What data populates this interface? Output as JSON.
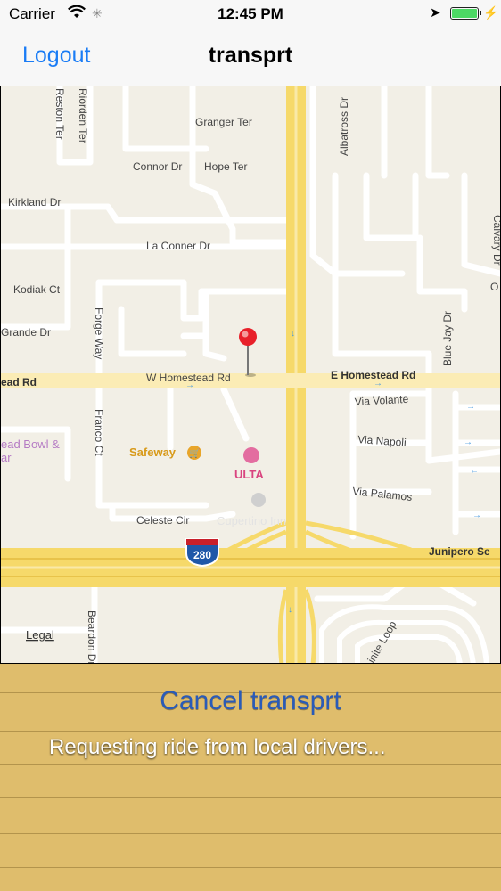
{
  "status_bar": {
    "carrier": "Carrier",
    "time": "12:45 PM",
    "wifi_icon": "wifi-icon",
    "location_icon": "location-arrow-icon",
    "battery_icon": "battery-icon",
    "battery_color": "#4cd964"
  },
  "navbar": {
    "logout_label": "Logout",
    "title": "transprt"
  },
  "map": {
    "streets": {
      "reston_ter": "Reston Ter",
      "riorden_ter": "Riorden Ter",
      "granger_ter": "Granger Ter",
      "connor_dr": "Connor Dr",
      "hope_ter": "Hope Ter",
      "albatross_dr": "Albatross Dr",
      "kirkland_dr": "Kirkland Dr",
      "la_conner_dr": "La Conner Dr",
      "calvary_dr": "Calvary Dr",
      "kodiak_ct": "Kodiak Ct",
      "grande_dr": "Grande Dr",
      "forge_way": "Forge Way",
      "blue_jay_dr": "Blue Jay Dr",
      "w_homestead": "W Homestead Rd",
      "e_homestead": "E Homestead Rd",
      "homestead_left": "ead Rd",
      "via_volante": "Via Volante",
      "via_napoli": "Via Napoli",
      "via_palamos": "Via Palamos",
      "franco_ct": "Franco Ct",
      "celeste_cir": "Celeste Cir",
      "junipero": "Junipero Se",
      "beardon_dr": "Beardon Dr",
      "inite_loop": "inite Loop",
      "legal": "Legal",
      "o_letter": "O"
    },
    "pois": {
      "bowl": "ead Bowl &",
      "bowl2": "ar",
      "safeway": "Safeway",
      "ulta": "ULTA",
      "cupertino_inn": "Cupertino Inn"
    },
    "highway_shield": "280",
    "colors": {
      "road_major": "#f6d96a",
      "road_minor": "#ffffff",
      "land": "#f2efe6",
      "poi_safeway": "#d89a1a",
      "poi_ulta": "#d9447f",
      "pin": "#e8202a"
    }
  },
  "panel": {
    "cancel_label": "Cancel transprt",
    "status_text": "Requesting ride from local drivers...",
    "text_color": "#2a5bb8"
  }
}
